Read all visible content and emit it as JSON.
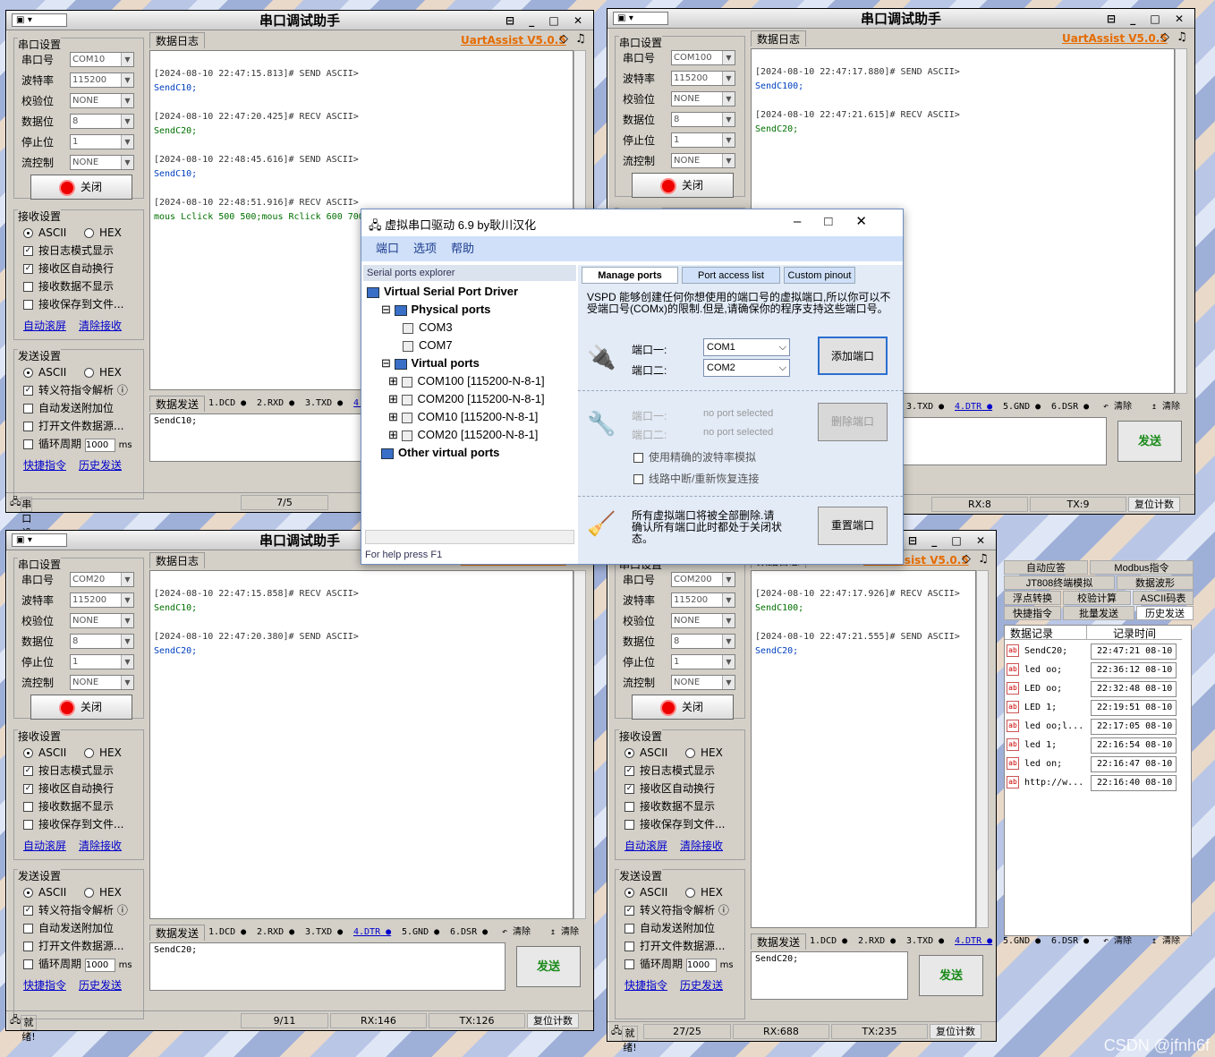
{
  "app_title": "串口调试助手",
  "brand": "UartAssist V5.0.5",
  "labels": {
    "serial_settings": "串口设置",
    "port": "串口号",
    "baud": "波特率",
    "parity": "校验位",
    "data_bits": "数据位",
    "stop_bits": "停止位",
    "flow": "流控制",
    "close": "关闭",
    "recv_settings": "接收设置",
    "send_settings": "发送设置",
    "ascii": "ASCII",
    "hex": "HEX",
    "log_mode": "按日志模式显示",
    "recv_wrap": "接收区自动换行",
    "recv_hide": "接收数据不显示",
    "recv_save": "接收保存到文件...",
    "auto_scroll": "自动滚屏",
    "clear_recv": "清除接收",
    "escape": "转义符指令解析",
    "auto_append": "自动发送附加位",
    "open_file": "打开文件数据源...",
    "loop": "循环周期",
    "loop_val": "1000",
    "ms": "ms",
    "quick": "快捷指令",
    "history": "历史发送",
    "data_log": "数据日志",
    "data_send": "数据发送",
    "send": "发送",
    "clear": "清除",
    "reset_count": "复位计数",
    "ready": "就绪!",
    "status_settings": "串口设置"
  },
  "signals": [
    "1.DCD",
    "2.RXD",
    "3.TXD",
    "4.DTR",
    "5.GND",
    "6.DSR"
  ],
  "win1": {
    "port": "COM10",
    "baud": "115200",
    "parity": "NONE",
    "bits": "8",
    "stop": "1",
    "flow": "NONE",
    "send_text": "SendC10;",
    "count": "7/5",
    "log": [
      {
        "ts": "[2024-08-10 22:47:15.813]# SEND ASCII>",
        "msg": "SendC10;",
        "k": "snd"
      },
      {
        "ts": "[2024-08-10 22:47:20.425]# RECV ASCII>",
        "msg": "SendC20;",
        "k": "rcv"
      },
      {
        "ts": "[2024-08-10 22:48:45.616]# SEND ASCII>",
        "msg": "SendC10;",
        "k": "snd"
      },
      {
        "ts": "[2024-08-10 22:48:51.916]# RECV ASCII>",
        "msg": "mous Lclick 500 500;mous Rclick 600 700",
        "k": "rcv"
      }
    ]
  },
  "win2": {
    "port": "COM100",
    "baud": "115200",
    "parity": "NONE",
    "bits": "8",
    "stop": "1",
    "flow": "NONE",
    "rx": "RX:8",
    "tx": "TX:9",
    "log": [
      {
        "ts": "[2024-08-10 22:47:17.880]# SEND ASCII>",
        "msg": "SendC100;",
        "k": "snd"
      },
      {
        "ts": "[2024-08-10 22:47:21.615]# RECV ASCII>",
        "msg": "SendC20;",
        "k": "rcv"
      }
    ]
  },
  "win3": {
    "port": "COM20",
    "baud": "115200",
    "parity": "NONE",
    "bits": "8",
    "stop": "1",
    "flow": "NONE",
    "send_text": "SendC20;",
    "count": "9/11",
    "rx": "RX:146",
    "tx": "TX:126",
    "log": [
      {
        "ts": "[2024-08-10 22:47:15.858]# RECV ASCII>",
        "msg": "SendC10;",
        "k": "rcv"
      },
      {
        "ts": "[2024-08-10 22:47:20.380]# SEND ASCII>",
        "msg": "SendC20;",
        "k": "snd"
      }
    ]
  },
  "win4": {
    "port": "COM200",
    "baud": "115200",
    "parity": "NONE",
    "bits": "8",
    "stop": "1",
    "flow": "NONE",
    "send_text": "SendC20;",
    "count": "27/25",
    "rx": "RX:688",
    "tx": "TX:235",
    "log": [
      {
        "ts": "[2024-08-10 22:47:17.926]# RECV ASCII>",
        "msg": "SendC100;",
        "k": "rcv"
      },
      {
        "ts": "[2024-08-10 22:47:21.555]# SEND ASCII>",
        "msg": "SendC20;",
        "k": "snd"
      }
    ]
  },
  "side": {
    "buttons": [
      "自动应答",
      "Modbus指令",
      "JT808终端模拟",
      "数据波形",
      "浮点转换",
      "校验计算",
      "ASCII码表",
      "快捷指令",
      "批量发送",
      "历史发送"
    ],
    "col_record": "数据记录",
    "col_time": "记录时间",
    "rows": [
      {
        "d": "SendC20;",
        "t": "22:47:21 08-10"
      },
      {
        "d": "led oo;",
        "t": "22:36:12 08-10"
      },
      {
        "d": "LED oo;",
        "t": "22:32:48 08-10"
      },
      {
        "d": "LED 1;",
        "t": "22:19:51 08-10"
      },
      {
        "d": "led oo;l...",
        "t": "22:17:05 08-10"
      },
      {
        "d": "led 1;",
        "t": "22:16:54 08-10"
      },
      {
        "d": "led on;",
        "t": "22:16:47 08-10"
      },
      {
        "d": "http://w...",
        "t": "22:16:40 08-10"
      }
    ]
  },
  "vspd": {
    "title": "虚拟串口驱动 6.9 by耿川汉化",
    "menu": [
      "端口",
      "选项",
      "帮助"
    ],
    "explorer": "Serial ports explorer",
    "root": "Virtual Serial Port Driver",
    "physical": "Physical ports",
    "phys": [
      "COM3",
      "COM7"
    ],
    "virtual": "Virtual ports",
    "virt": [
      "COM100 [115200-N-8-1]",
      "COM200 [115200-N-8-1]",
      "COM10 [115200-N-8-1]",
      "COM20 [115200-N-8-1]"
    ],
    "other": "Other virtual ports",
    "help": "For help press F1",
    "tabs": [
      "Manage ports",
      "Port access list",
      "Custom pinout"
    ],
    "desc": "VSPD 能够创建任何你想使用的端口号的虚拟端口,所以你可以不受端口号(COMx)的限制.但是,请确保你的程序支持这些端口号。",
    "port1": "端口一:",
    "port2": "端口二:",
    "p1": "COM1",
    "p2": "COM2",
    "add": "添加端口",
    "none1": "no port selected",
    "none2": "no port selected",
    "del": "删除端口",
    "opt1": "使用精确的波特率模拟",
    "opt2": "线路中断/重新恢复连接",
    "reset_desc": "所有虚拟端口将被全部删除.请确认所有端口此时都处于关闭状态。",
    "reset": "重置端口"
  },
  "watermark": "CSDN @jfnh6f"
}
